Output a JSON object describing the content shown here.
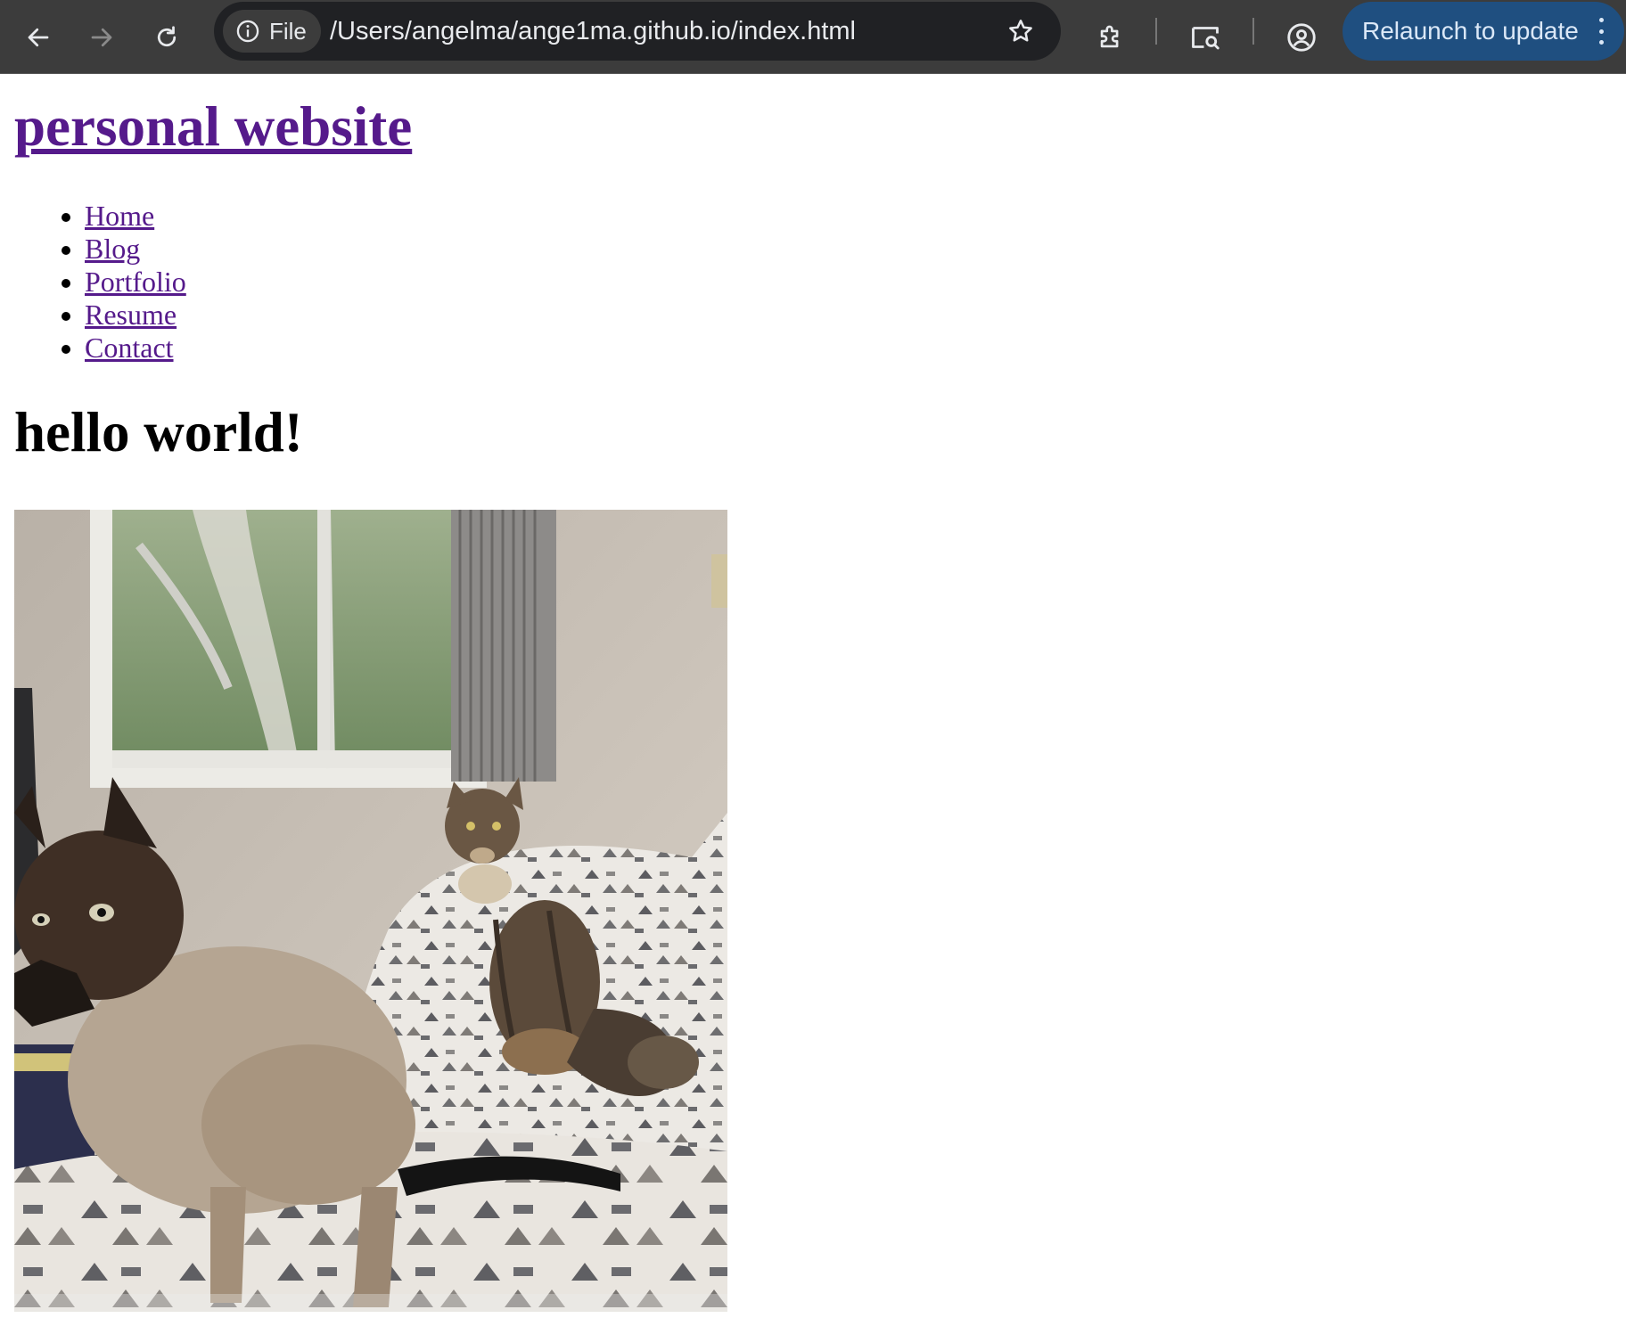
{
  "browser": {
    "site_chip_label": "File",
    "url": "/Users/angelma/ange1ma.github.io/index.html",
    "relaunch_label": "Relaunch to update",
    "icons": {
      "back": "arrow-left-icon",
      "forward": "arrow-right-icon",
      "reload": "reload-icon",
      "info": "info-icon",
      "bookmark": "star-icon",
      "extensions": "puzzle-icon",
      "tab_search": "tab-search-icon",
      "profile": "profile-icon",
      "menu": "kebab-menu-icon"
    },
    "colors": {
      "toolbar": "#3c3c3c",
      "omnibox": "#202124",
      "relaunch": "#1f4f80"
    }
  },
  "page": {
    "site_title": "personal website",
    "nav": [
      "Home",
      "Blog",
      "Portfolio",
      "Resume",
      "Contact"
    ],
    "heading": "hello world!",
    "link_color": "#551a8b"
  }
}
